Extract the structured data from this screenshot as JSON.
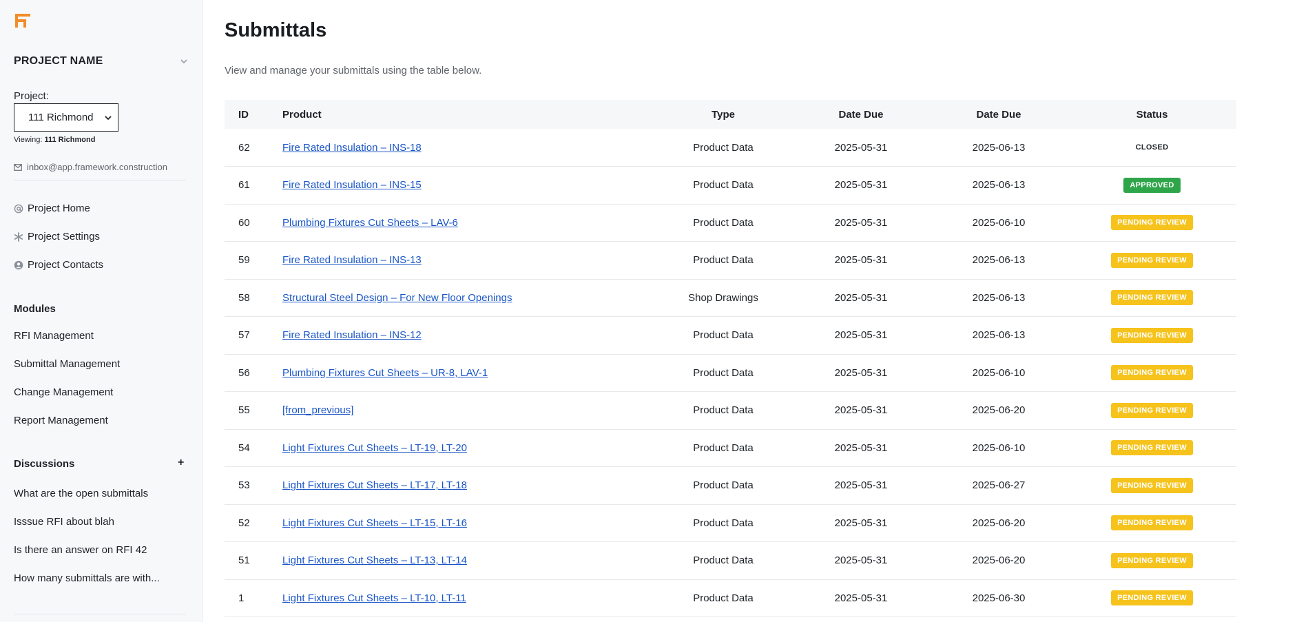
{
  "sidebar": {
    "project_name": "PROJECT NAME",
    "project_label": "Project:",
    "project_select_value": "111 Richmond",
    "viewing_prefix": "Viewing:",
    "viewing_value": "111 Richmond",
    "inbox_email": "inbox@app.framework.construction",
    "nav": [
      {
        "label": "Project Home",
        "icon": "at-icon"
      },
      {
        "label": "Project Settings",
        "icon": "asterisk-icon"
      },
      {
        "label": "Project Contacts",
        "icon": "user-circle-icon"
      }
    ],
    "modules_title": "Modules",
    "modules": [
      "RFI Management",
      "Submittal Management",
      "Change Management",
      "Report Management"
    ],
    "discussions_title": "Discussions",
    "discussions_add": "+",
    "discussions": [
      "What are the open submittals",
      "Isssue RFI about blah",
      "Is there an answer on RFI 42",
      "How many submittals are with..."
    ]
  },
  "main": {
    "title": "Submittals",
    "subtitle": "View and manage your submittals using the table below.",
    "columns": [
      "ID",
      "Product",
      "Type",
      "Date Due",
      "Date Due",
      "Status"
    ],
    "rows": [
      {
        "id": "62",
        "product": "Fire Rated Insulation – INS-18",
        "type": "Product Data",
        "d1": "2025-05-31",
        "d2": "2025-06-13",
        "status": "CLOSED"
      },
      {
        "id": "61",
        "product": "Fire Rated Insulation – INS-15",
        "type": "Product Data",
        "d1": "2025-05-31",
        "d2": "2025-06-13",
        "status": "APPROVED"
      },
      {
        "id": "60",
        "product": "Plumbing Fixtures Cut Sheets – LAV-6",
        "type": "Product Data",
        "d1": "2025-05-31",
        "d2": "2025-06-10",
        "status": "PENDING REVIEW"
      },
      {
        "id": "59",
        "product": "Fire Rated Insulation – INS-13",
        "type": "Product Data",
        "d1": "2025-05-31",
        "d2": "2025-06-13",
        "status": "PENDING REVIEW"
      },
      {
        "id": "58",
        "product": "Structural Steel Design – For New Floor Openings",
        "type": "Shop Drawings",
        "d1": "2025-05-31",
        "d2": "2025-06-13",
        "status": "PENDING REVIEW"
      },
      {
        "id": "57",
        "product": "Fire Rated Insulation – INS-12",
        "type": "Product Data",
        "d1": "2025-05-31",
        "d2": "2025-06-13",
        "status": "PENDING REVIEW"
      },
      {
        "id": "56",
        "product": "Plumbing Fixtures Cut Sheets – UR-8, LAV-1",
        "type": "Product Data",
        "d1": "2025-05-31",
        "d2": "2025-06-10",
        "status": "PENDING REVIEW"
      },
      {
        "id": "55",
        "product": "[from_previous]",
        "type": "Product Data",
        "d1": "2025-05-31",
        "d2": "2025-06-20",
        "status": "PENDING REVIEW"
      },
      {
        "id": "54",
        "product": "Light Fixtures Cut Sheets – LT-19, LT-20",
        "type": "Product Data",
        "d1": "2025-05-31",
        "d2": "2025-06-10",
        "status": "PENDING REVIEW"
      },
      {
        "id": "53",
        "product": "Light Fixtures Cut Sheets – LT-17, LT-18",
        "type": "Product Data",
        "d1": "2025-05-31",
        "d2": "2025-06-27",
        "status": "PENDING REVIEW"
      },
      {
        "id": "52",
        "product": "Light Fixtures Cut Sheets – LT-15, LT-16",
        "type": "Product Data",
        "d1": "2025-05-31",
        "d2": "2025-06-20",
        "status": "PENDING REVIEW"
      },
      {
        "id": "51",
        "product": "Light Fixtures Cut Sheets – LT-13, LT-14",
        "type": "Product Data",
        "d1": "2025-05-31",
        "d2": "2025-06-20",
        "status": "PENDING REVIEW"
      },
      {
        "id": "1",
        "product": "Light Fixtures Cut Sheets – LT-10, LT-11",
        "type": "Product Data",
        "d1": "2025-05-31",
        "d2": "2025-06-30",
        "status": "PENDING REVIEW"
      }
    ]
  },
  "colors": {
    "brand": "#f28c28",
    "link": "#1a56c7",
    "approved": "#2fa54a",
    "pending": "#f6c31c"
  }
}
